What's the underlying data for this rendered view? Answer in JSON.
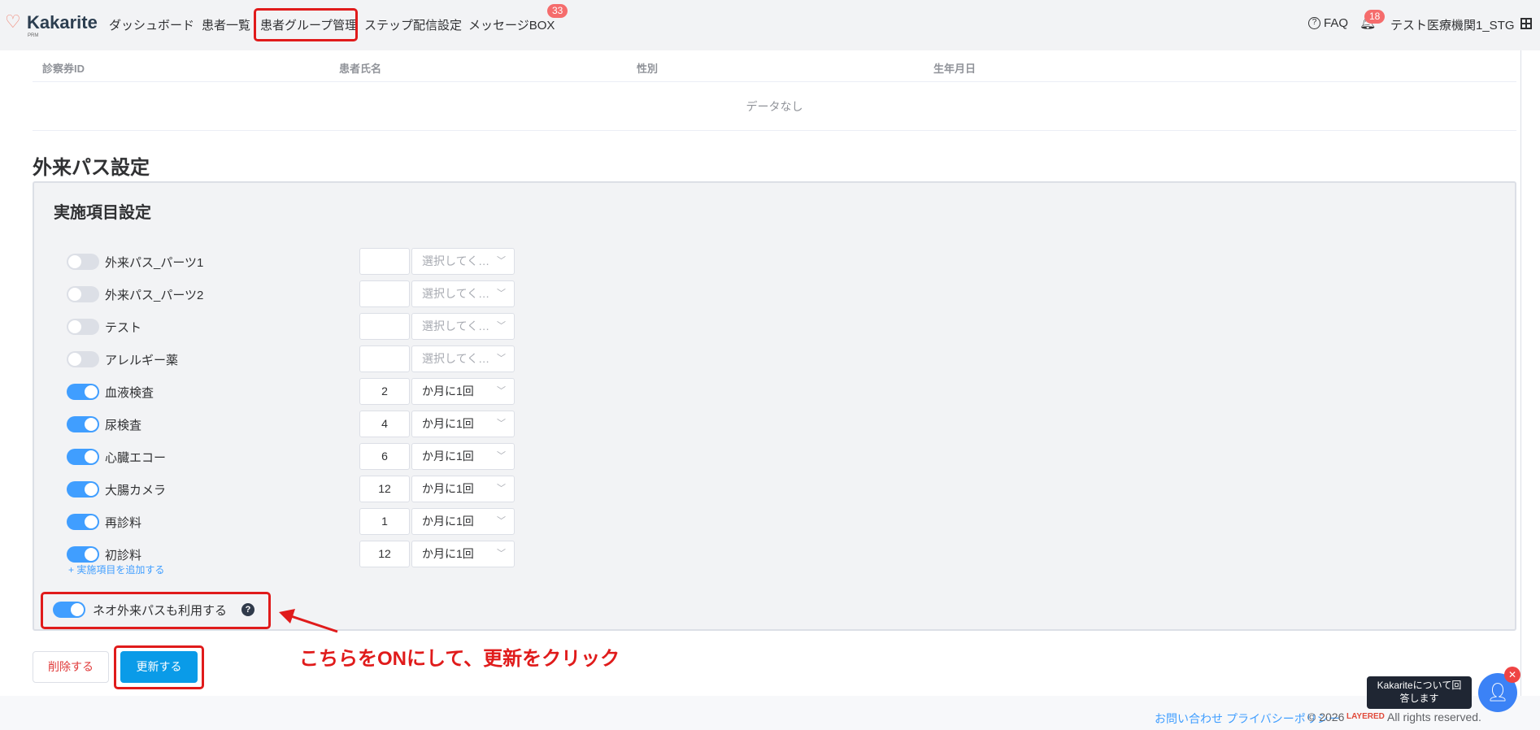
{
  "header": {
    "logo": "Kakarite",
    "logo_sub": "PRM",
    "nav": [
      "ダッシュボード",
      "患者一覧",
      "患者グループ管理",
      "ステップ配信設定",
      "メッセージBOX"
    ],
    "message_badge": "33",
    "faq": "FAQ",
    "notif_badge": "18",
    "org": "テスト医療機関1_STG"
  },
  "table": {
    "headers": [
      "診察券ID",
      "患者氏名",
      "性別",
      "生年月日"
    ],
    "empty": "データなし"
  },
  "section_title": "外来パス設定",
  "box_title": "実施項目設定",
  "items": [
    {
      "label": "外来パス_パーツ1",
      "on": false,
      "value": "",
      "unit": "選択してく…"
    },
    {
      "label": "外来パス_パーツ2",
      "on": false,
      "value": "",
      "unit": "選択してく…"
    },
    {
      "label": "テスト",
      "on": false,
      "value": "",
      "unit": "選択してく…"
    },
    {
      "label": "アレルギー薬",
      "on": false,
      "value": "",
      "unit": "選択してく…"
    },
    {
      "label": "血液検査",
      "on": true,
      "value": "2",
      "unit": "か月に1回"
    },
    {
      "label": "尿検査",
      "on": true,
      "value": "4",
      "unit": "か月に1回"
    },
    {
      "label": "心臓エコー",
      "on": true,
      "value": "6",
      "unit": "か月に1回"
    },
    {
      "label": "大腸カメラ",
      "on": true,
      "value": "12",
      "unit": "か月に1回"
    },
    {
      "label": "再診料",
      "on": true,
      "value": "1",
      "unit": "か月に1回"
    },
    {
      "label": "初診料",
      "on": true,
      "value": "12",
      "unit": "か月に1回"
    }
  ],
  "add_item": "+ 実施項目を追加する",
  "neo_toggle": {
    "label": "ネオ外来パスも利用する",
    "on": true
  },
  "buttons": {
    "delete": "削除する",
    "update": "更新する"
  },
  "annotation": "こちらをONにして、更新をクリック",
  "footer": {
    "contact": "お問い合わせ",
    "privacy": "プライバシーポリシー",
    "copyright": "© 2026",
    "brand": "LAYERED",
    "rights": "All rights reserved."
  },
  "chat": {
    "bubble": "Kakariteについて回答します"
  }
}
